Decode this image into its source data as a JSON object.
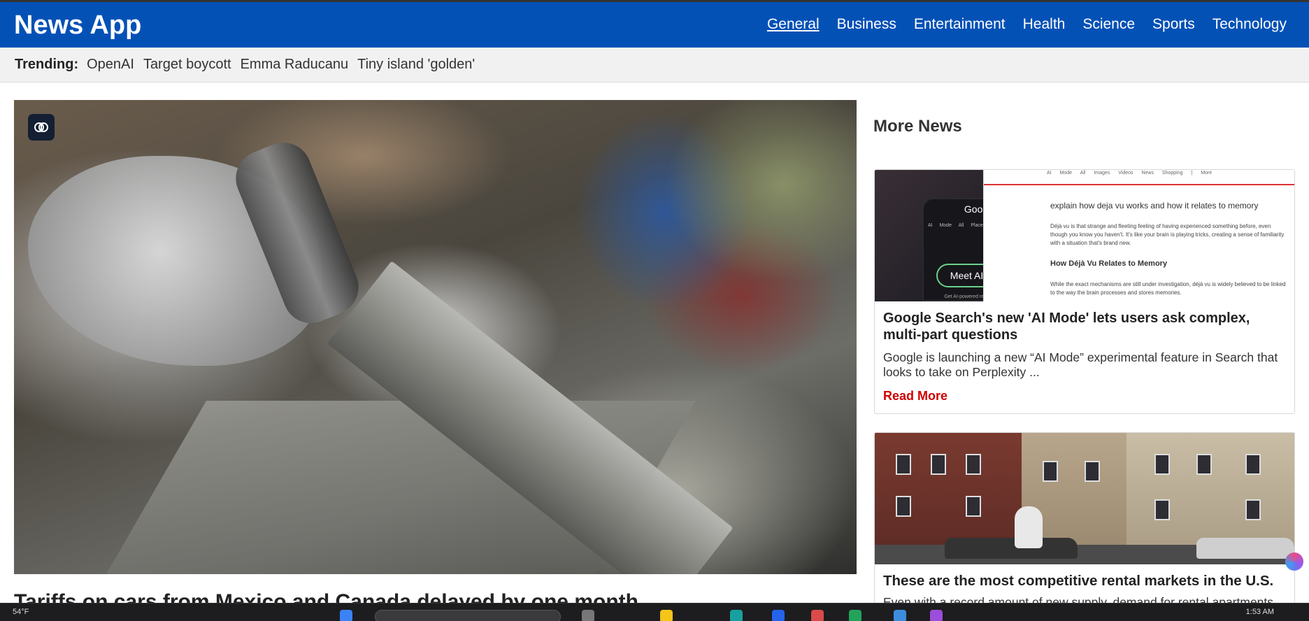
{
  "app": {
    "title": "News App"
  },
  "nav": {
    "items": [
      {
        "label": "General",
        "active": true
      },
      {
        "label": "Business"
      },
      {
        "label": "Entertainment"
      },
      {
        "label": "Health"
      },
      {
        "label": "Science"
      },
      {
        "label": "Sports"
      },
      {
        "label": "Technology"
      }
    ]
  },
  "trending": {
    "label": "Trending:",
    "items": [
      "OpenAI",
      "Target boycott",
      "Emma Raducanu",
      "Tiny island 'golden'"
    ]
  },
  "hero": {
    "badge_icon": "brain-icon",
    "title": "Tariffs on cars from Mexico and Canada delayed by one month"
  },
  "side": {
    "title": "More News",
    "cards": [
      {
        "title": "Google Search's new 'AI Mode' lets users ask complex, multi-part questions",
        "description": "Google is launching a new “AI Mode” experimental feature in Search that looks to take on Perplexity ...",
        "read_more": "Read More",
        "image": {
          "phone_title": "Google",
          "phone_tabs": "AI Mode All Places Maps Images",
          "phone_button": "Meet AI Mode",
          "phone_sub": "Get AI-powered responses & ask",
          "topbar": "AI Mode All Images Videos News Shopping | More",
          "query": "explain how deja vu works and how it relates to memory",
          "para1": "Déjà vu is that strange and fleeting feeling of having experienced something before, even though you know you haven't. It's like your brain is playing tricks, creating a sense of familiarity with a situation that's brand new.",
          "heading": "How Déjà Vu Relates to Memory",
          "para2": "While the exact mechanisms are still under investigation, déjà vu is widely believed to be linked to the way the brain processes and stores memories."
        }
      },
      {
        "title": "These are the most competitive rental markets in the U.S.",
        "description": "Even with a record amount of new supply, demand for rental apartments"
      }
    ]
  },
  "taskbar": {
    "left_text": "54°F",
    "time": "1:53 AM"
  },
  "colors": {
    "header_bg": "#0451b6",
    "read_more": "#d00000",
    "trending_bg": "#f1f1f1"
  }
}
